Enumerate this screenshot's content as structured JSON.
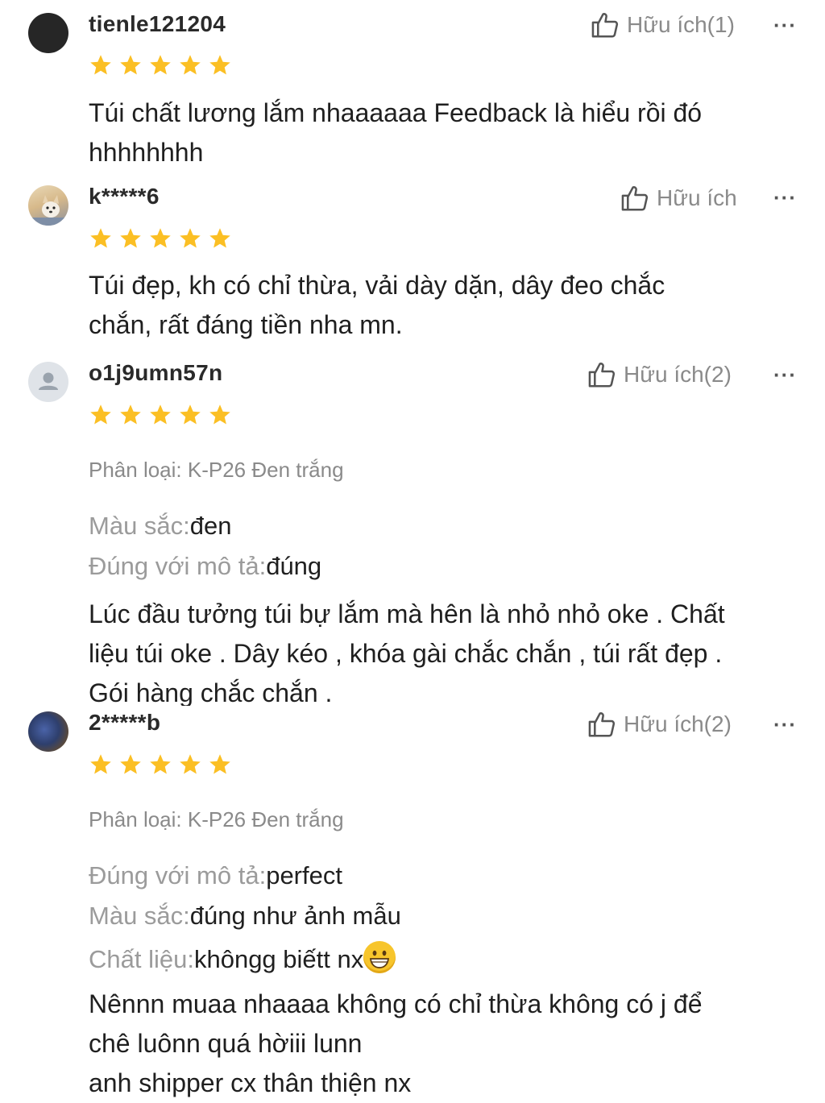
{
  "colors": {
    "star": "#fbbf24",
    "muted": "#8a8a8a",
    "text": "#1f1f1f"
  },
  "reviews": [
    {
      "username": "tienle121204",
      "helpful_label": "Hữu ích(1)",
      "more_label": "···",
      "rating": 5,
      "avatar": "dark-circle",
      "variant": "",
      "attributes": [],
      "text": "Túi chất lương lắm nhaaaaaa Feedback là hiểu rồi đó\nhhhhhhhh"
    },
    {
      "username": "k*****6",
      "helpful_label": "Hữu ích",
      "more_label": "···",
      "rating": 5,
      "avatar": "dog-photo",
      "variant": "",
      "attributes": [],
      "text": "Túi đẹp, kh có chỉ thừa, vải dày dặn, dây đeo chắc\nchắn, rất đáng tiền nha mn."
    },
    {
      "username": "o1j9umn57n",
      "helpful_label": "Hữu ích(2)",
      "more_label": "···",
      "rating": 5,
      "avatar": "default-user",
      "variant": "Phân loại: K-P26 Đen trắng",
      "attributes": [
        {
          "key": "Màu sắc:",
          "value": "đen"
        },
        {
          "key": "Đúng với mô tả:",
          "value": "đúng"
        }
      ],
      "text": "Lúc đầu tưởng túi bự lắm mà hên là nhỏ nhỏ oke . Chất\nliệu túi oke . Dây kéo , khóa gài chắc chắn , túi rất đẹp .\nGói hàng chắc chắn ."
    },
    {
      "username": "2*****b",
      "helpful_label": "Hữu ích(2)",
      "more_label": "···",
      "rating": 5,
      "avatar": "blue-photo",
      "variant": "Phân loại: K-P26 Đen trắng",
      "attributes": [
        {
          "key": "Đúng với mô tả:",
          "value": "perfect"
        },
        {
          "key": "Màu sắc:",
          "value": "đúng như ảnh mẫu"
        },
        {
          "key": "Chất liệu:",
          "value": "khôngg biếtt nx"
        }
      ],
      "emoji": "grinning-face-emoji",
      "text": "Nênnn muaa nhaaaa không có chỉ thừa không có j để\nchê luônn quá hờiii lunn\nanh shipper cx thân thiện nx"
    }
  ]
}
